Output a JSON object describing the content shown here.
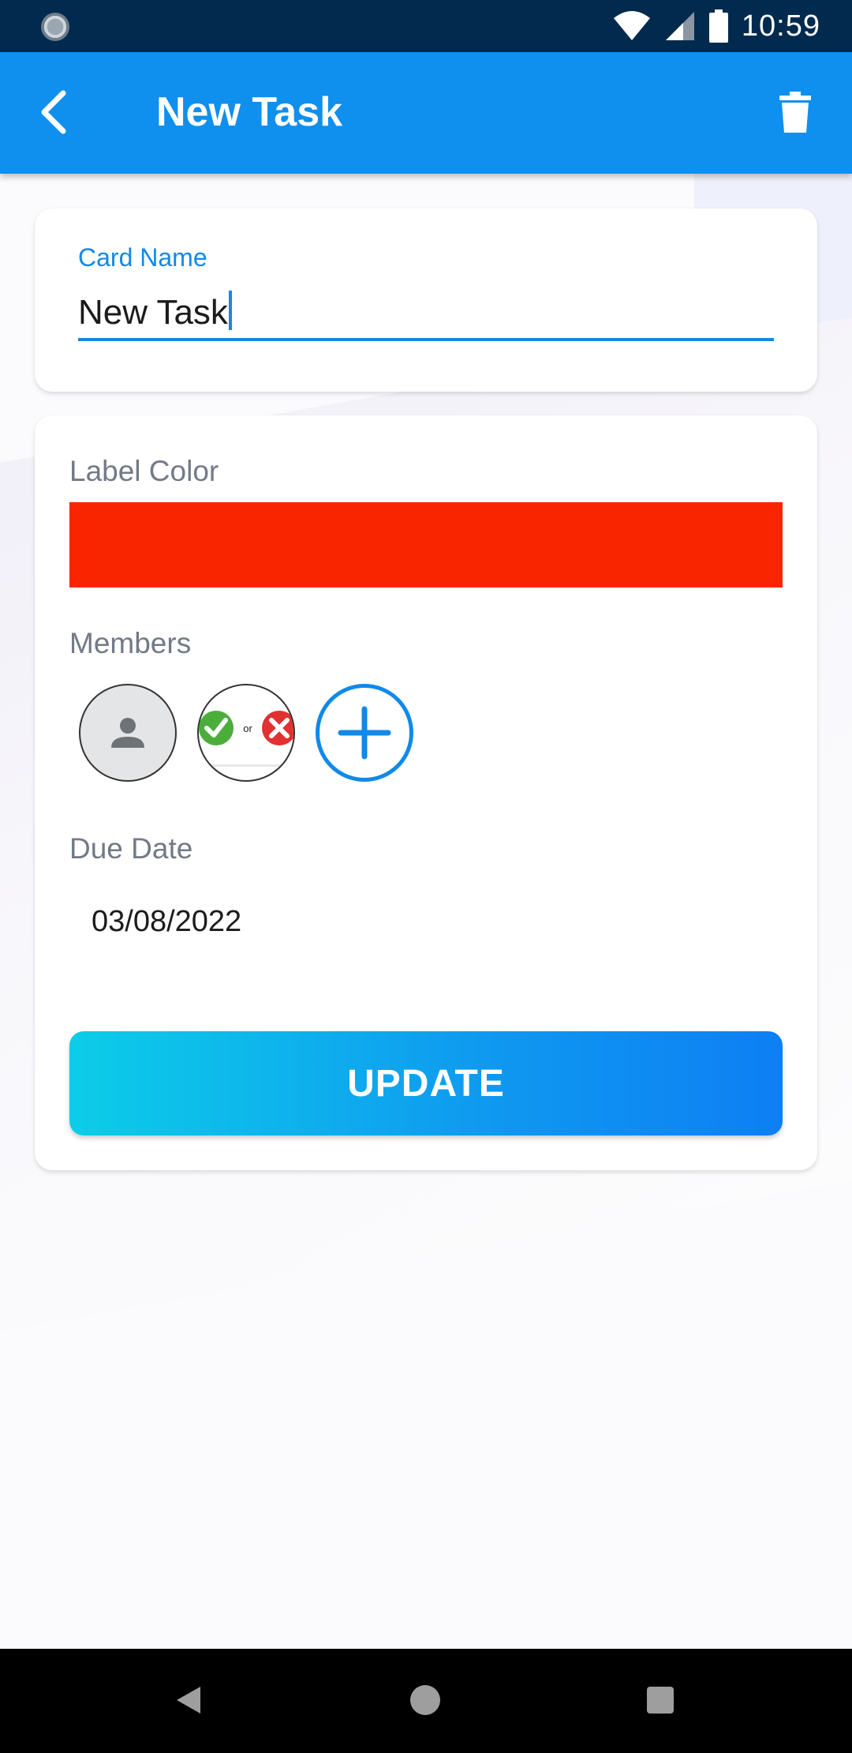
{
  "status_bar": {
    "time": "10:59"
  },
  "app_bar": {
    "title": "New Task",
    "back_icon": "chevron-left-icon",
    "delete_icon": "trash-icon"
  },
  "card_name": {
    "label": "Card Name",
    "value": "New Task"
  },
  "details": {
    "label_color_title": "Label Color",
    "label_color_value": "#f82500",
    "members_title": "Members",
    "members": [
      {
        "type": "placeholder",
        "icon": "person-icon"
      },
      {
        "type": "image",
        "icon": "check-or-cross-icon",
        "text": "or"
      }
    ],
    "add_member_icon": "plus-icon",
    "due_date_title": "Due Date",
    "due_date_value": "03/08/2022",
    "update_label": "UPDATE"
  },
  "colors": {
    "accent": "#1189e8",
    "app_bar": "#0f8fee",
    "status_bar": "#022a4e"
  }
}
